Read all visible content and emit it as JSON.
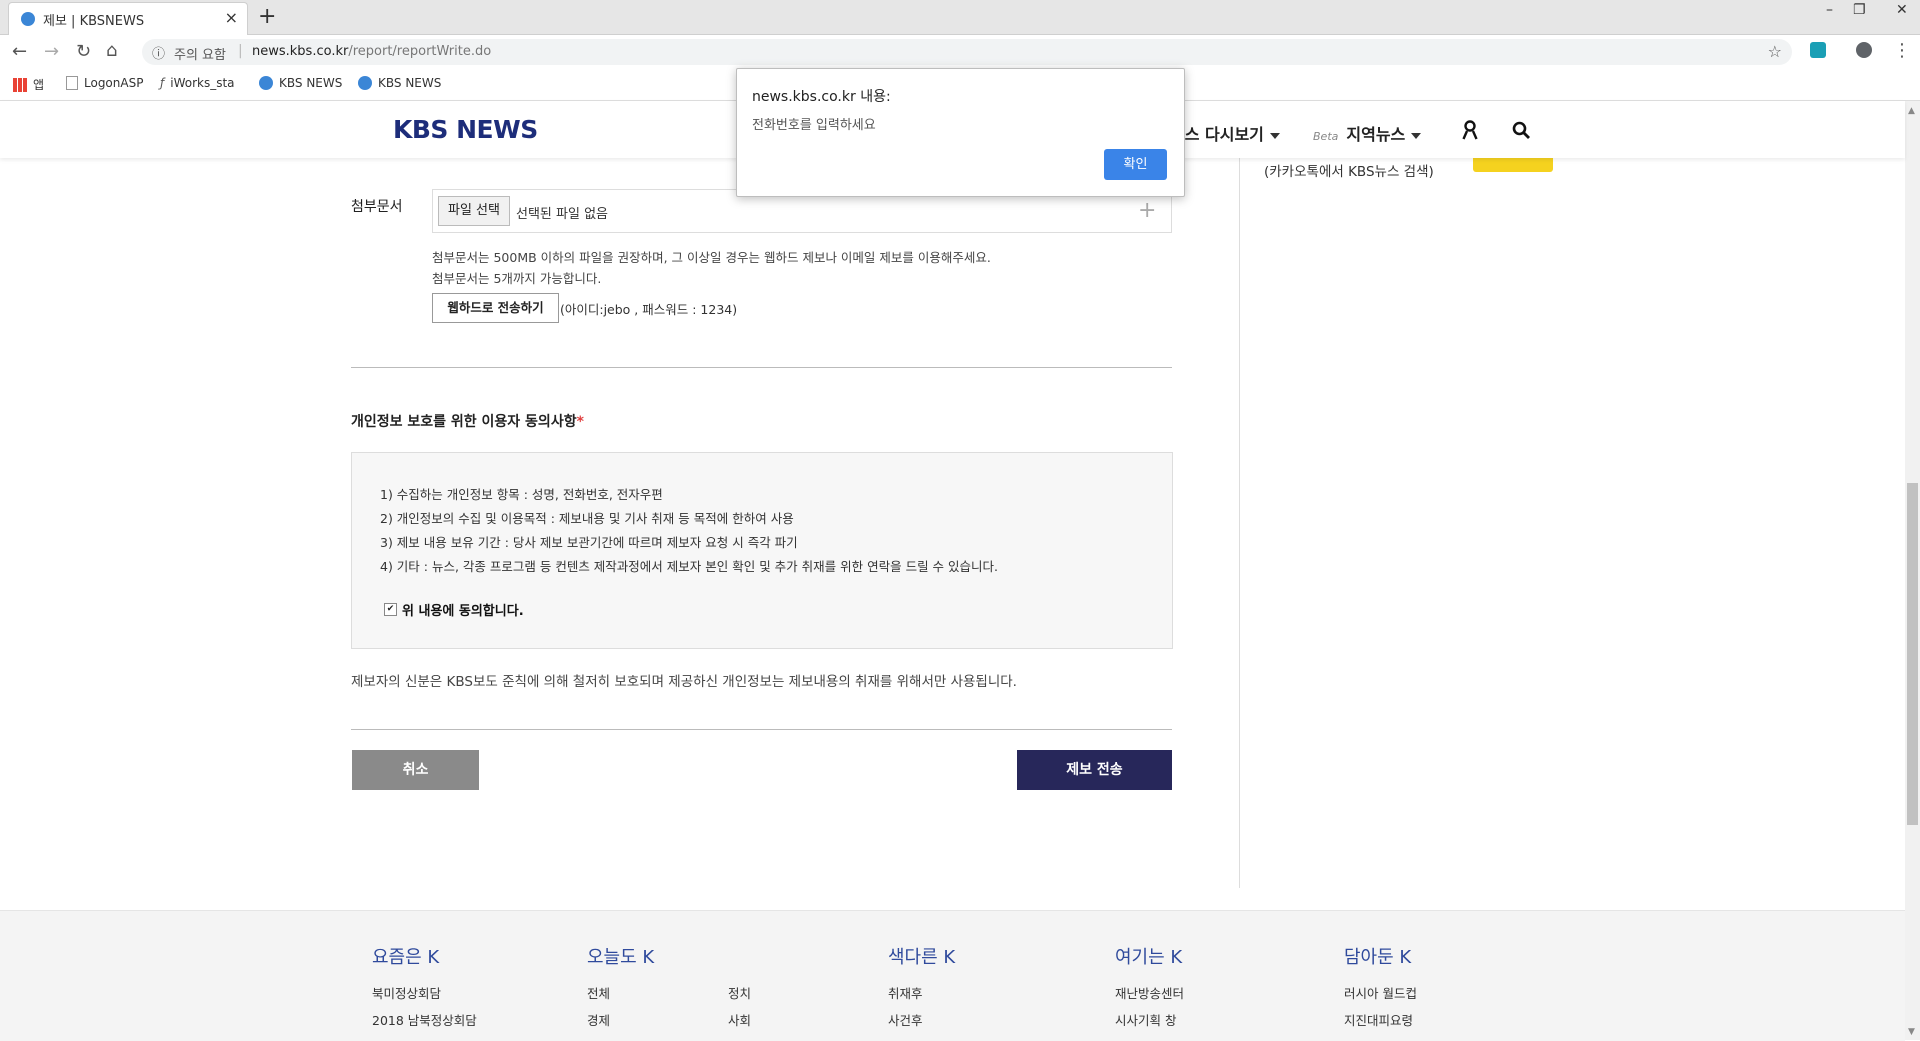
{
  "browser": {
    "tab_title": "제보 | KBSNEWS",
    "new_tab": "+",
    "window_controls": [
      "–",
      "❐",
      "✕"
    ],
    "security_label": "주의 요함",
    "url_host": "news.kbs.co.kr",
    "url_path": "/report/reportWrite.do",
    "bookmarks": [
      "앱",
      "LogonASP",
      "iWorks_sta",
      "KBS NEWS",
      "KBS NEWS"
    ]
  },
  "header": {
    "logo": "KBS NEWS",
    "menu_replay": "뉴스 다시보기",
    "beta": "Beta",
    "menu_local": "지역뉴스"
  },
  "form": {
    "attach_label": "첨부문서",
    "file_button": "파일 선택",
    "file_none": "선택된 파일 없음",
    "file_plus": "+",
    "note1": "첨부문서는 500MB 이하의 파일을 권장하며, 그 이상일 경우는 웹하드 제보나 이메일 제보를 이용해주세요.",
    "note2": "첨부문서는 5개까지 가능합니다.",
    "webhard_button": "웹하드로 전송하기",
    "webhard_note": "(아이디:jebo , 패스워드 : 1234)",
    "consent_title": "개인정보 보호를 위한 이용자 동의사항",
    "consent_required": "*",
    "consent_items": [
      "1) 수집하는 개인정보 항목 : 성명, 전화번호, 전자우편",
      "2) 개인정보의 수집 및 이용목적 : 제보내용 및 기사 취재 등 목적에 한하여 사용",
      "3) 제보 내용 보유 기간 : 당사 제보 보관기간에 따르며 제보자 요청 시 즉각 파기",
      "4) 기타 : 뉴스, 각종 프로그램 등 컨텐츠 제작과정에서 제보자 본인 확인 및 추가 취재를 위한 연락을 드릴 수 있습니다."
    ],
    "agree_check": "✔",
    "agree_label": "위 내용에 동의합니다.",
    "privacy_note": "제보자의 신분은 KBS보도 준칙에 의해 철저히 보호되며 제공하신 개인정보는 제보내용의 취재를 위해서만 사용됩니다.",
    "cancel": "취소",
    "submit": "제보 전송"
  },
  "sidebar": {
    "kakao_text": "(카카오톡에서 KBS뉴스 검색)"
  },
  "footer": {
    "columns": [
      {
        "title": "요즘은 K",
        "links": [
          "북미정상회담",
          "2018 남북정상회담"
        ]
      },
      {
        "title": "오늘도 K",
        "links": [
          "전체",
          "경제"
        ],
        "links2": [
          "정치",
          "사회"
        ]
      },
      {
        "title": "색다른 K",
        "links": [
          "취재후",
          "사건후"
        ]
      },
      {
        "title": "여기는 K",
        "links": [
          "재난방송센터",
          "시사기획 창"
        ]
      },
      {
        "title": "담아둔 K",
        "links": [
          "러시아 월드컵",
          "지진대피요령"
        ]
      }
    ]
  },
  "alert": {
    "title": "news.kbs.co.kr 내용:",
    "message": "전화번호를 입력하세요",
    "ok": "확인"
  }
}
